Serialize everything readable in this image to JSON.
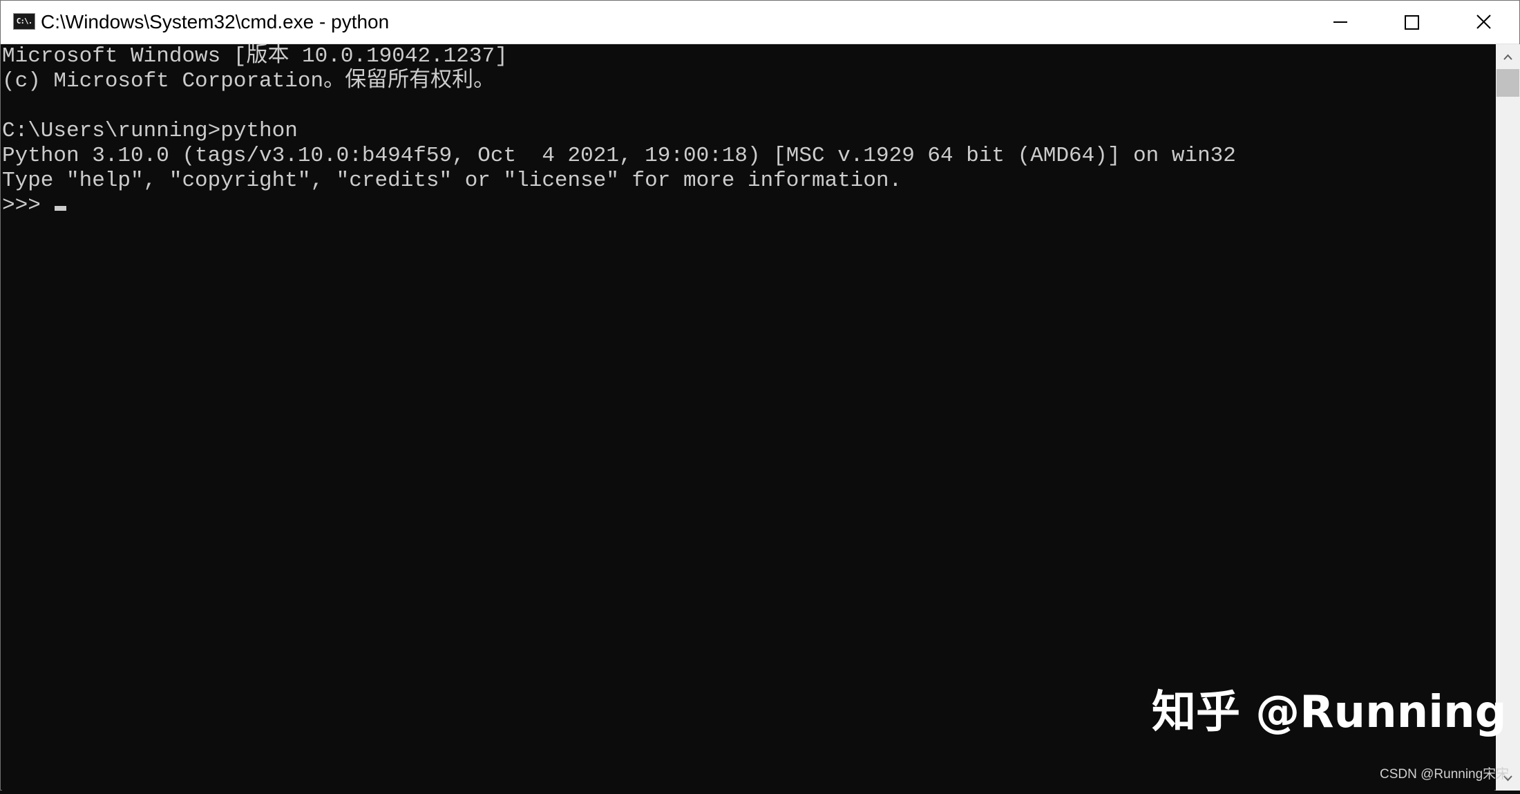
{
  "window": {
    "title": "C:\\Windows\\System32\\cmd.exe - python",
    "icon": "cmd-icon",
    "icon_text": "C:\\."
  },
  "caption_buttons": {
    "minimize": "minimize-icon",
    "maximize": "maximize-icon",
    "close": "close-icon"
  },
  "console": {
    "lines": [
      "Microsoft Windows [版本 10.0.19042.1237]",
      "(c) Microsoft Corporation。保留所有权利。",
      "",
      "C:\\Users\\running>python",
      "Python 3.10.0 (tags/v3.10.0:b494f59, Oct  4 2021, 19:00:18) [MSC v.1929 64 bit (AMD64)] on win32",
      "Type \"help\", \"copyright\", \"credits\" or \"license\" for more information."
    ],
    "prompt": ">>> "
  },
  "scrollbar": {
    "up_icon": "scroll-up-arrow-icon",
    "down_icon": "scroll-down-arrow-icon"
  },
  "watermarks": {
    "zhihu": "知乎 @Running",
    "csdn": "CSDN @Running宋宋"
  },
  "colors": {
    "console_bg": "#0c0c0c",
    "console_fg": "#cccccc",
    "titlebar_bg": "#ffffff"
  }
}
